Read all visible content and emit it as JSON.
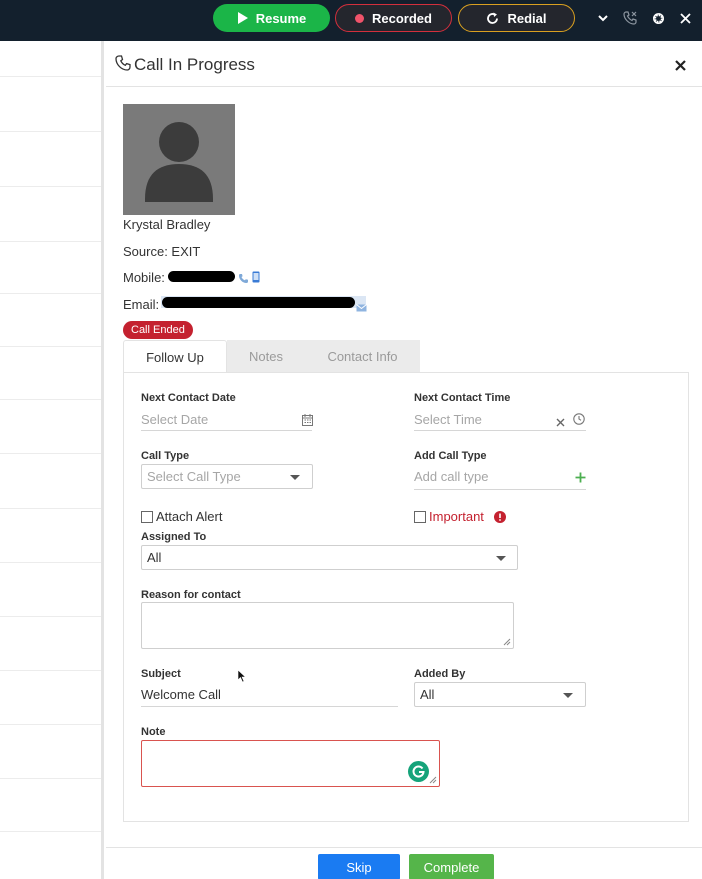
{
  "topbar": {
    "resume_label": "Resume",
    "recorded_label": "Recorded",
    "redial_label": "Redial"
  },
  "modal": {
    "title": "Call In Progress"
  },
  "contact": {
    "name": "Krystal Bradley",
    "source": "Source: EXIT",
    "mobile_label": "Mobile:",
    "email_label": "Email:"
  },
  "status": {
    "badge": "Call Ended"
  },
  "tabs": [
    {
      "label": "Follow Up"
    },
    {
      "label": "Notes"
    },
    {
      "label": "Contact Info"
    }
  ],
  "form": {
    "next_contact_date_label": "Next Contact Date",
    "next_contact_date_placeholder": "Select Date",
    "next_contact_time_label": "Next Contact Time",
    "next_contact_time_placeholder": "Select Time",
    "call_type_label": "Call Type",
    "call_type_placeholder": "Select Call Type",
    "add_call_type_label": "Add Call Type",
    "add_call_type_placeholder": "Add call type",
    "attach_alert_label": "Attach Alert",
    "important_label": "Important",
    "assigned_to_label": "Assigned To",
    "assigned_to_value": "All",
    "reason_label": "Reason for contact",
    "subject_label": "Subject",
    "subject_value": "Welcome Call",
    "added_by_label": "Added By",
    "added_by_value": "All",
    "note_label": "Note"
  },
  "footer": {
    "skip_label": "Skip",
    "complete_label": "Complete"
  }
}
